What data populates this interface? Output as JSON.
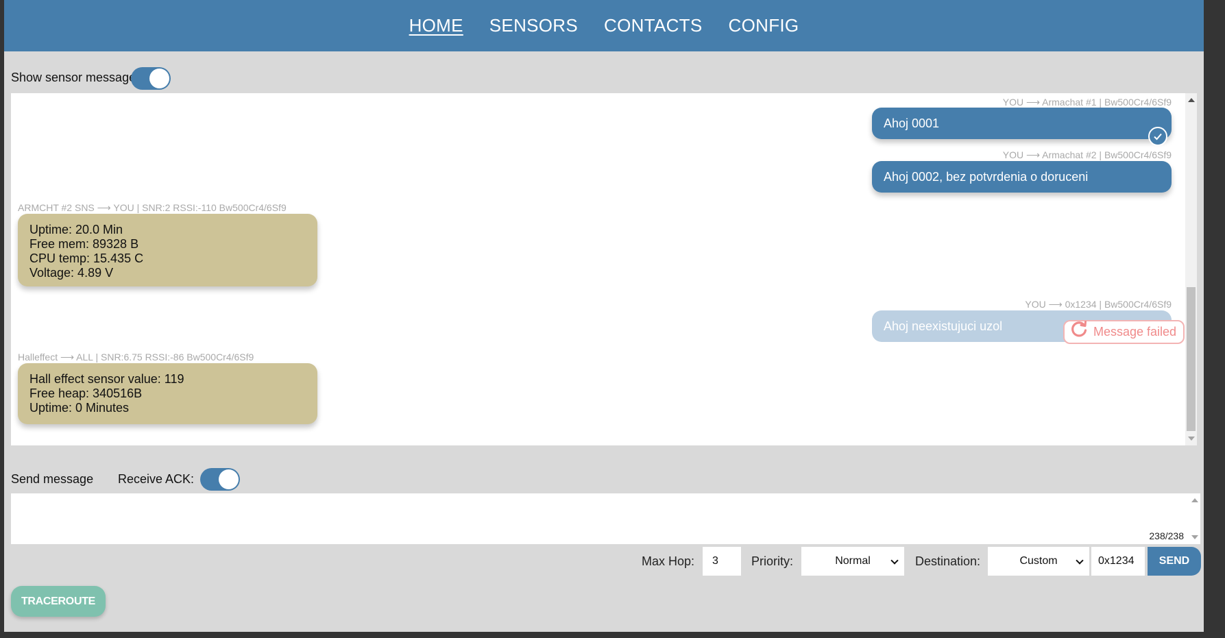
{
  "nav": {
    "items": [
      {
        "label": "HOME",
        "active": true
      },
      {
        "label": "SENSORS"
      },
      {
        "label": "CONTACTS"
      },
      {
        "label": "CONFIG"
      }
    ]
  },
  "show_sensor_label": "Show sensor messages",
  "show_sensor_on": true,
  "messages": {
    "m1": {
      "meta": "YOU ⟶ Armachat #1 | Bw500Cr4/6Sf9",
      "text": "Ahoj 0001",
      "acked": true
    },
    "m2": {
      "meta": "YOU ⟶ Armachat #2 | Bw500Cr4/6Sf9",
      "text": "Ahoj 0002, bez potvrdenia o doruceni"
    },
    "s1": {
      "meta": "ARMCHT #2 SNS ⟶ YOU | SNR:2 RSSI:-110 Bw500Cr4/6Sf9",
      "lines": [
        "Uptime: 20.0 Min",
        "Free mem: 89328 B",
        "CPU temp: 15.435 C",
        "Voltage: 4.89 V"
      ]
    },
    "m3": {
      "meta": "YOU ⟶ 0x1234 | Bw500Cr4/6Sf9",
      "text": "Ahoj neexistujuci uzol",
      "fail_label": "Message failed"
    },
    "s2": {
      "meta": "Halleffect ⟶ ALL | SNR:6.75 RSSI:-86 Bw500Cr4/6Sf9",
      "lines": [
        "Hall effect sensor value: 119",
        "Free heap: 340516B",
        "Uptime: 0 Minutes"
      ]
    }
  },
  "composer": {
    "send_message_label": "Send message",
    "receive_ack_label": "Receive ACK:",
    "receive_ack_on": true,
    "text": "",
    "counter": "238/238"
  },
  "controls": {
    "max_hop_label": "Max Hop:",
    "max_hop_value": "3",
    "priority_label": "Priority:",
    "priority_value": "Normal",
    "destination_label": "Destination:",
    "destination_value": "Custom",
    "custom_address": "0x1234",
    "send_label": "SEND",
    "traceroute_label": "TRACEROUTE"
  },
  "colors": {
    "primary": "#467eac",
    "sensor_bubble": "#cdc397",
    "failed": "#f08a8a",
    "traceroute": "#7fc1ae"
  }
}
